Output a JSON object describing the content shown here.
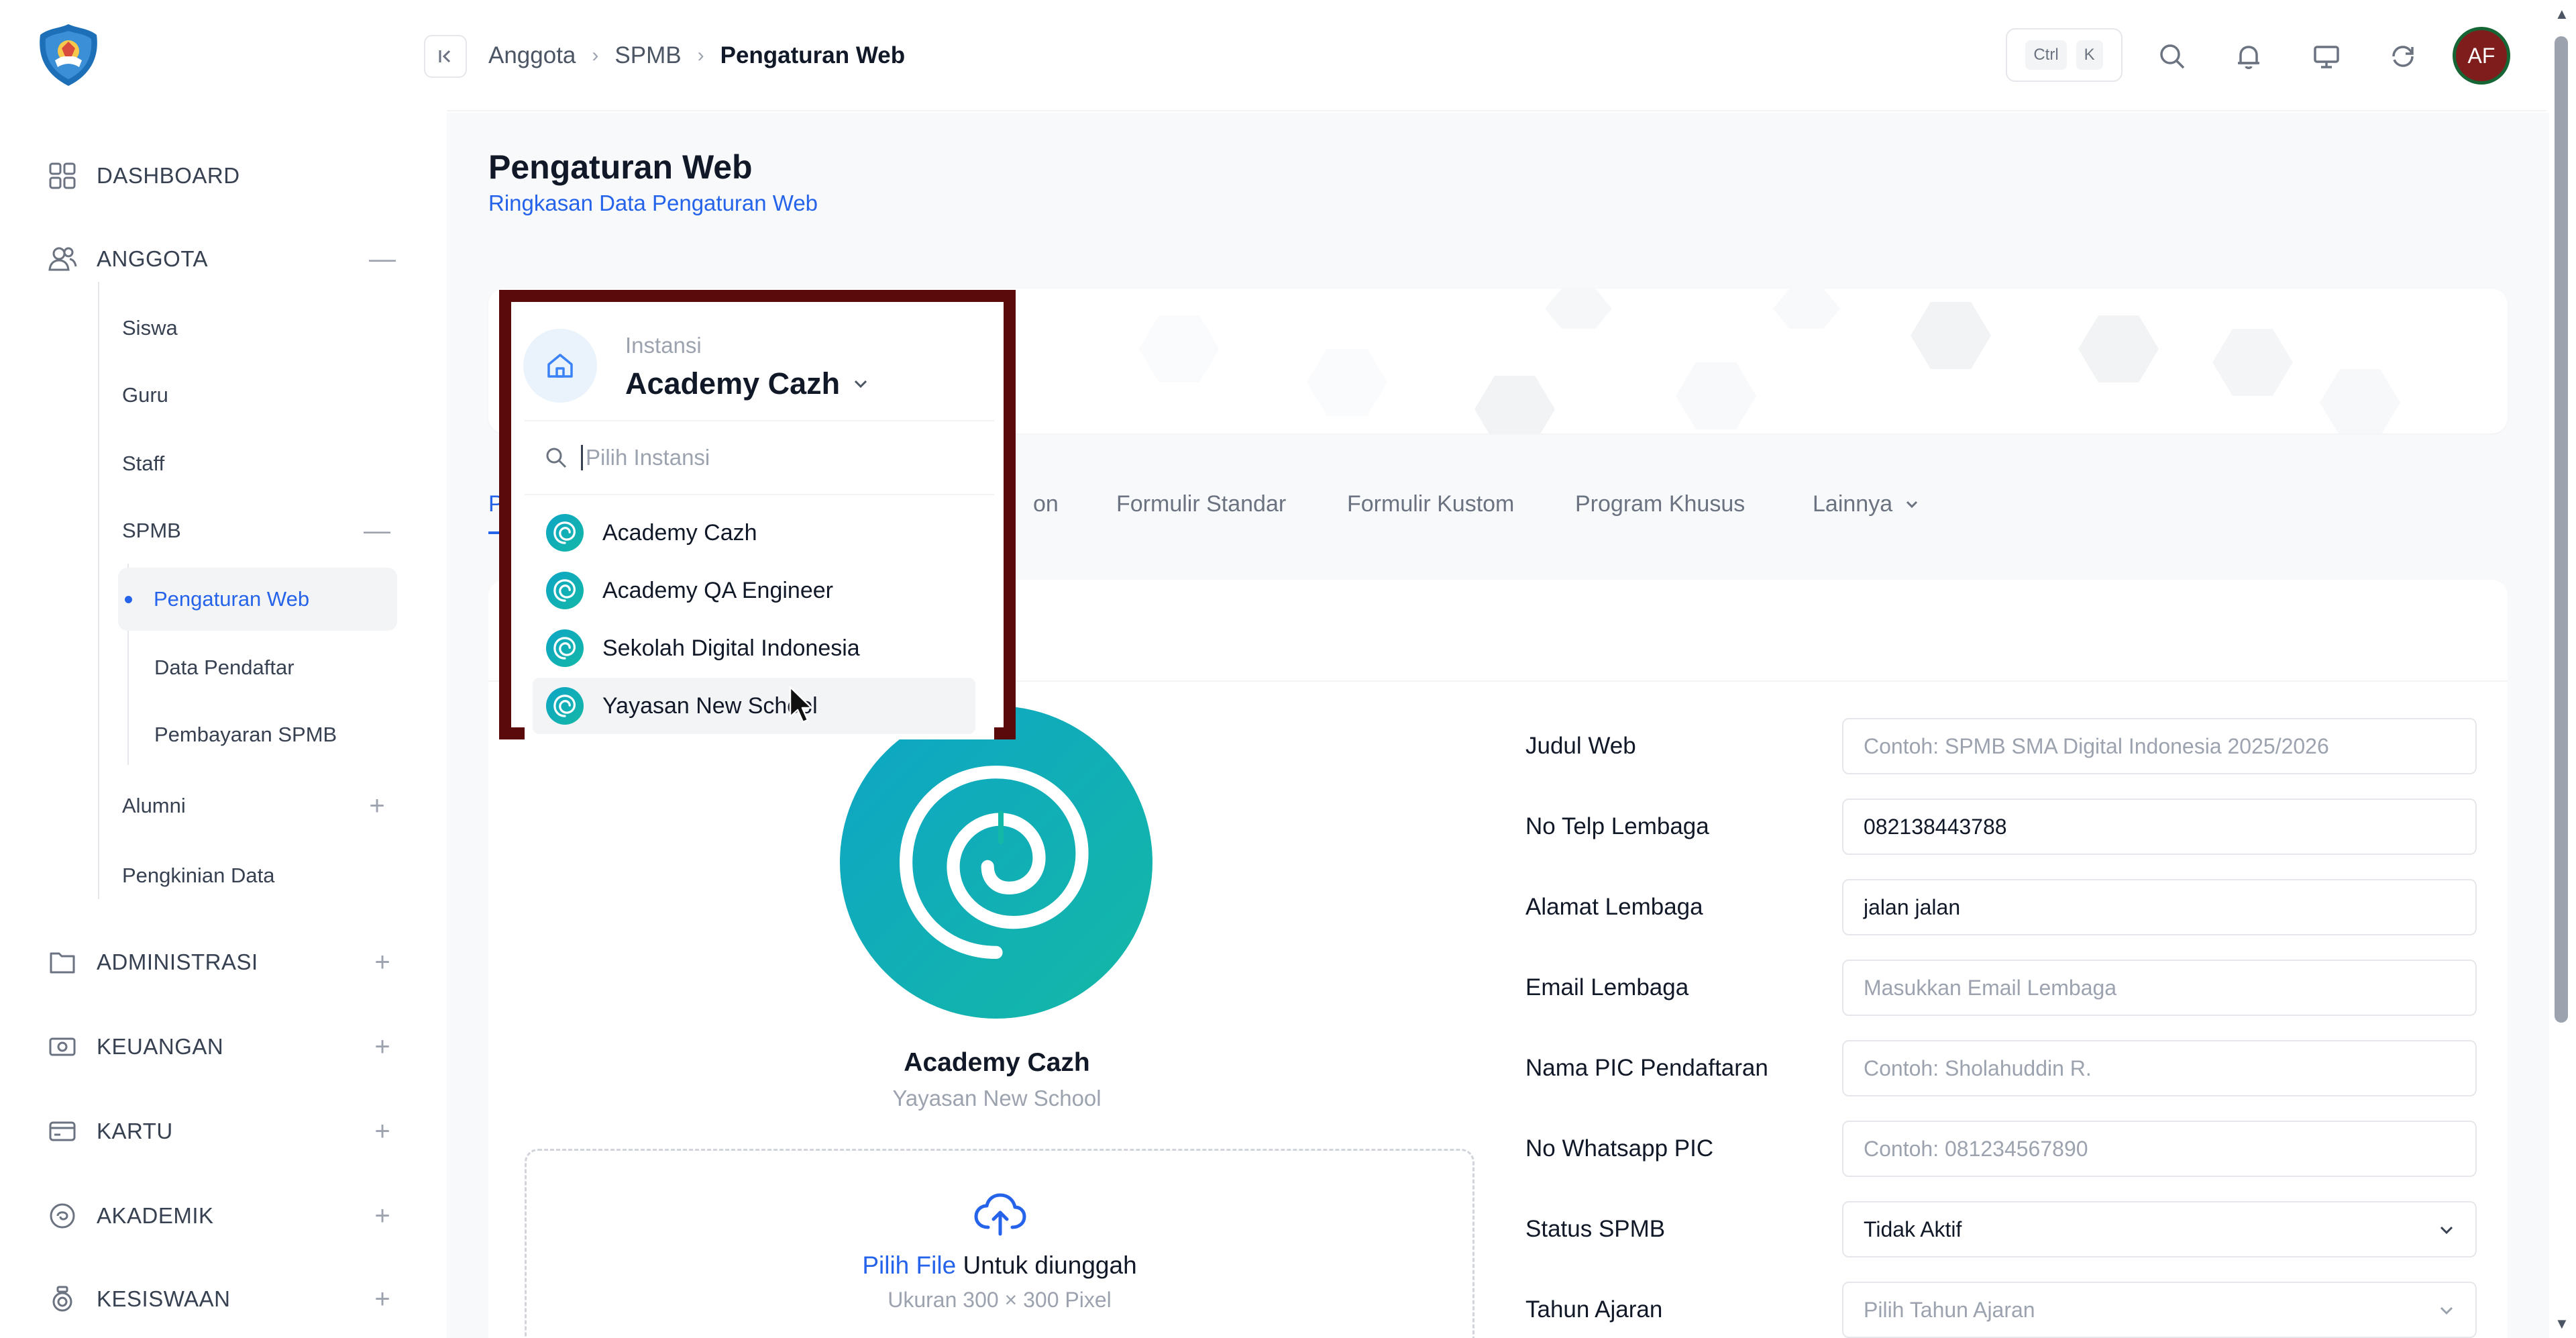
{
  "sidebar": {
    "nav": [
      {
        "label": "DASHBOARD",
        "icon": "grid-icon"
      },
      {
        "label": "ANGGOTA",
        "icon": "users-icon",
        "toggle": "—"
      },
      {
        "label": "ADMINISTRASI",
        "icon": "folder-icon",
        "toggle": "+"
      },
      {
        "label": "KEUANGAN",
        "icon": "money-icon",
        "toggle": "+"
      },
      {
        "label": "KARTU",
        "icon": "card-icon",
        "toggle": "+"
      },
      {
        "label": "AKADEMIK",
        "icon": "book-icon",
        "toggle": "+"
      },
      {
        "label": "KESISWAAN",
        "icon": "badge-icon",
        "toggle": "+"
      }
    ],
    "anggota_children": [
      "Siswa",
      "Guru",
      "Staff",
      "SPMB",
      "Alumni",
      "Pengkinian Data"
    ],
    "spmb_toggle": "—",
    "alumni_toggle": "+",
    "spmb_children": [
      "Pengaturan Web",
      "Data Pendaftar",
      "Pembayaran SPMB"
    ]
  },
  "topbar": {
    "breadcrumb": [
      "Anggota",
      "SPMB",
      "Pengaturan Web"
    ],
    "kbd": [
      "Ctrl",
      "K"
    ],
    "avatar_initials": "AF",
    "icons": [
      "search-icon",
      "bell-icon",
      "monitor-icon",
      "refresh-icon"
    ]
  },
  "page": {
    "title": "Pengaturan Web",
    "subtitle": "Ringkasan Data Pengaturan Web"
  },
  "tabs": {
    "active_fragment": "P",
    "hidden_fragment": "on",
    "items": [
      "Formulir Standar",
      "Formulir Kustom",
      "Program Khusus",
      "Lainnya"
    ]
  },
  "institution": {
    "name": "Academy Cazh",
    "parent": "Yayasan New School"
  },
  "upload": {
    "link": "Pilih File",
    "text": " Untuk diunggah",
    "hint": "Ukuran 300 × 300 Pixel"
  },
  "form": {
    "fields": [
      {
        "label": "Judul Web",
        "value": "",
        "placeholder": "Contoh: SPMB SMA Digital Indonesia 2025/2026"
      },
      {
        "label": "No Telp Lembaga",
        "value": "082138443788",
        "placeholder": ""
      },
      {
        "label": "Alamat Lembaga",
        "value": "jalan jalan",
        "placeholder": ""
      },
      {
        "label": "Email Lembaga",
        "value": "",
        "placeholder": "Masukkan Email Lembaga"
      },
      {
        "label": "Nama PIC Pendaftaran",
        "value": "",
        "placeholder": "Contoh: Sholahuddin R."
      },
      {
        "label": "No Whatsapp PIC",
        "value": "",
        "placeholder": "Contoh: 081234567890"
      },
      {
        "label": "Status SPMB",
        "value": "Tidak Aktif",
        "placeholder": ""
      },
      {
        "label": "Tahun Ajaran",
        "value": "",
        "placeholder": "Pilih Tahun Ajaran"
      }
    ]
  },
  "instansi_dropdown": {
    "caption": "Instansi",
    "current": "Academy Cazh",
    "search_placeholder": "Pilih Instansi",
    "options": [
      "Academy Cazh",
      "Academy QA Engineer",
      "Sekolah Digital Indonesia",
      "Yayasan New School"
    ],
    "highlight_color": "#5a0a0a"
  },
  "colors": {
    "accent": "#2563eb",
    "teal": "#14b8a6",
    "avatar_bg": "#7f1d1d"
  }
}
